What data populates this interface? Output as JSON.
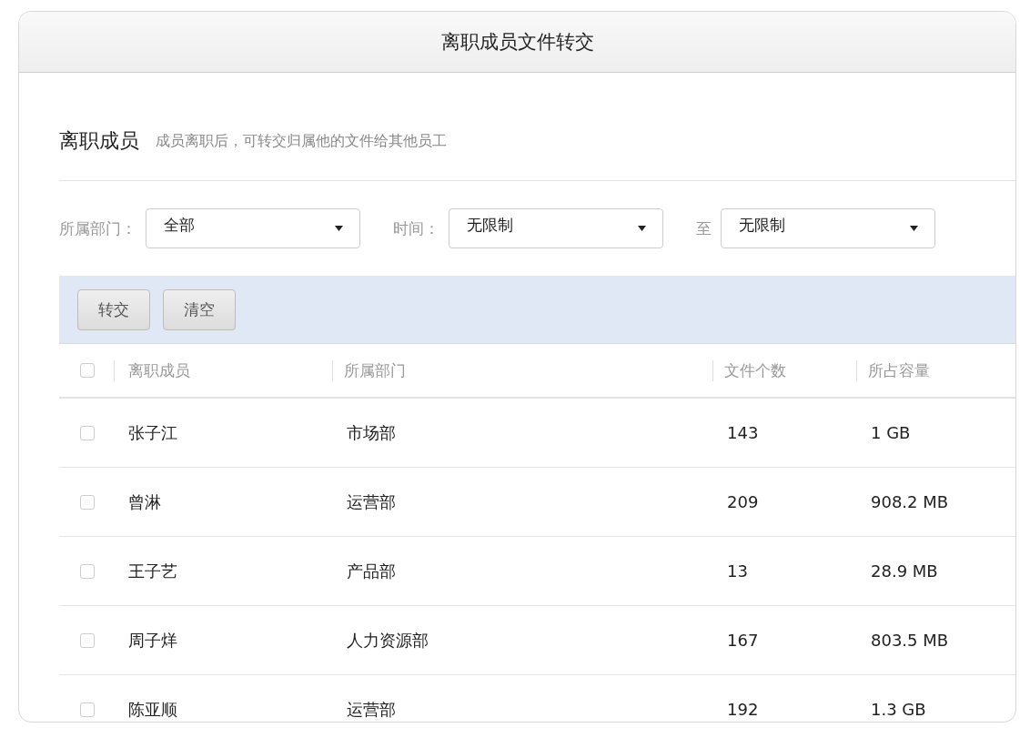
{
  "window": {
    "title": "离职成员文件转交"
  },
  "section": {
    "title": "离职成员",
    "description": "成员离职后，可转交归属他的文件给其他员工"
  },
  "filters": [
    {
      "kind": "select",
      "label": "所属部门：",
      "value": "全部"
    },
    {
      "kind": "select",
      "label": "时间：",
      "value": "无限制"
    },
    {
      "kind": "select",
      "label": "至",
      "value": "无限制"
    }
  ],
  "toolbar": {
    "buttons": [
      "转交",
      "清空"
    ]
  },
  "table": {
    "select_all": {
      "checked": false
    },
    "columns": [
      "离职成员",
      "所属部门",
      "文件个数",
      "所占容量"
    ],
    "rows": [
      {
        "checked": false,
        "cells": [
          "张子江",
          "市场部",
          "143",
          "1 GB"
        ]
      },
      {
        "checked": false,
        "cells": [
          "曾淋",
          "运营部",
          "209",
          "908.2 MB"
        ]
      },
      {
        "checked": false,
        "cells": [
          "王子艺",
          "产品部",
          "13",
          "28.9 MB"
        ]
      },
      {
        "checked": false,
        "cells": [
          "周子烊",
          "人力资源部",
          "167",
          "803.5 MB"
        ]
      },
      {
        "checked": false,
        "cells": [
          "陈亚顺",
          "运营部",
          "192",
          "1.3 GB"
        ]
      }
    ]
  }
}
